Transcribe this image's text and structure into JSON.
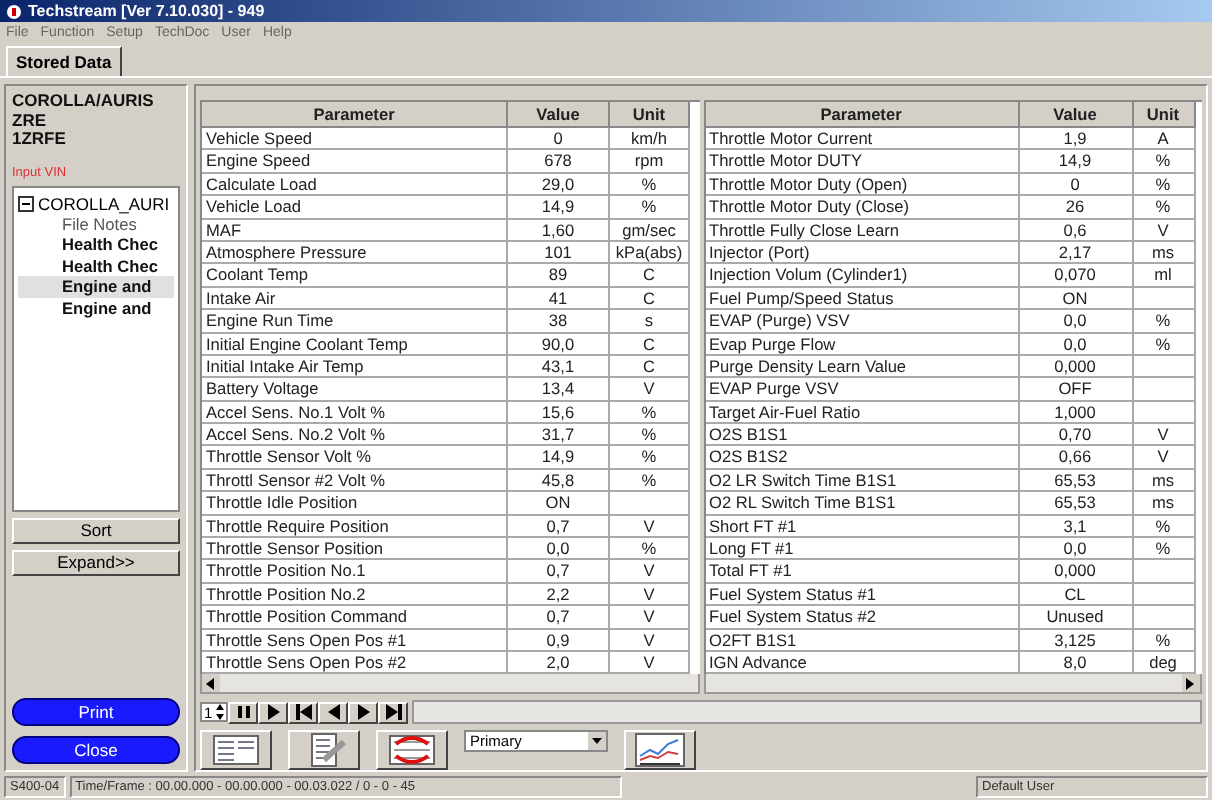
{
  "window": {
    "title": "Techstream [Ver 7.10.030] - 949"
  },
  "menu": [
    "File",
    "Function",
    "Setup",
    "TechDoc",
    "User",
    "Help"
  ],
  "tabs": [
    {
      "label": "Stored Data",
      "selected": true
    }
  ],
  "sidebar": {
    "vehicle": [
      "COROLLA/AURIS",
      "ZRE",
      "1ZRFE"
    ],
    "input_vin": "Input VIN",
    "tree": {
      "label": "COROLLA_AURI",
      "expanded": true,
      "children": [
        {
          "label": "File Notes",
          "bold": false,
          "selected": false
        },
        {
          "label": "Health Chec",
          "bold": true,
          "selected": false
        },
        {
          "label": "Health Chec",
          "bold": true,
          "selected": false
        },
        {
          "label": "Engine and",
          "bold": true,
          "selected": true
        },
        {
          "label": "Engine and",
          "bold": true,
          "selected": false
        }
      ]
    },
    "buttons": [
      "Sort",
      "Expand>>"
    ],
    "actions": [
      "Print",
      "Close"
    ]
  },
  "tables": [
    {
      "columns": [
        "Parameter",
        "Value",
        "Unit"
      ],
      "rows": [
        {
          "parameter": "Vehicle Speed",
          "value": "0",
          "unit": "km/h"
        },
        {
          "parameter": "Engine Speed",
          "value": "678",
          "unit": "rpm"
        },
        {
          "parameter": "Calculate Load",
          "value": "29,0",
          "unit": "%"
        },
        {
          "parameter": "Vehicle Load",
          "value": "14,9",
          "unit": "%"
        },
        {
          "parameter": "MAF",
          "value": "1,60",
          "unit": "gm/sec"
        },
        {
          "parameter": "Atmosphere Pressure",
          "value": "101",
          "unit": "kPa(abs)"
        },
        {
          "parameter": "Coolant Temp",
          "value": "89",
          "unit": "C"
        },
        {
          "parameter": "Intake Air",
          "value": "41",
          "unit": "C"
        },
        {
          "parameter": "Engine Run Time",
          "value": "38",
          "unit": "s"
        },
        {
          "parameter": "Initial Engine Coolant Temp",
          "value": "90,0",
          "unit": "C"
        },
        {
          "parameter": "Initial Intake Air Temp",
          "value": "43,1",
          "unit": "C"
        },
        {
          "parameter": "Battery Voltage",
          "value": "13,4",
          "unit": "V"
        },
        {
          "parameter": "Accel Sens. No.1 Volt %",
          "value": "15,6",
          "unit": "%"
        },
        {
          "parameter": "Accel Sens. No.2 Volt %",
          "value": "31,7",
          "unit": "%"
        },
        {
          "parameter": "Throttle Sensor Volt %",
          "value": "14,9",
          "unit": "%"
        },
        {
          "parameter": "Throttl Sensor #2 Volt %",
          "value": "45,8",
          "unit": "%"
        },
        {
          "parameter": "Throttle Idle Position",
          "value": "ON"
        },
        {
          "parameter": "Throttle Require Position",
          "value": "0,7",
          "unit": "V"
        },
        {
          "parameter": "Throttle Sensor Position",
          "value": "0,0",
          "unit": "%"
        },
        {
          "parameter": "Throttle Position No.1",
          "value": "0,7",
          "unit": "V"
        },
        {
          "parameter": "Throttle Position No.2",
          "value": "2,2",
          "unit": "V"
        },
        {
          "parameter": "Throttle Position Command",
          "value": "0,7",
          "unit": "V"
        },
        {
          "parameter": "Throttle Sens Open Pos #1",
          "value": "0,9",
          "unit": "V"
        },
        {
          "parameter": "Throttle Sens Open Pos #2",
          "value": "2,0",
          "unit": "V"
        }
      ]
    },
    {
      "columns": [
        "Parameter",
        "Value",
        "Unit"
      ],
      "rows": [
        {
          "parameter": "Throttle Motor Current",
          "value": "1,9",
          "unit": "A"
        },
        {
          "parameter": "Throttle Motor DUTY",
          "value": "14,9",
          "unit": "%"
        },
        {
          "parameter": "Throttle Motor Duty (Open)",
          "value": "0",
          "unit": "%"
        },
        {
          "parameter": "Throttle Motor Duty (Close)",
          "value": "26",
          "unit": "%"
        },
        {
          "parameter": "Throttle Fully Close Learn",
          "value": "0,6",
          "unit": "V"
        },
        {
          "parameter": "Injector (Port)",
          "value": "2,17",
          "unit": "ms"
        },
        {
          "parameter": "Injection Volum (Cylinder1)",
          "value": "0,070",
          "unit": "ml"
        },
        {
          "parameter": "Fuel Pump/Speed Status",
          "value": "ON"
        },
        {
          "parameter": "EVAP (Purge) VSV",
          "value": "0,0",
          "unit": "%"
        },
        {
          "parameter": "Evap Purge Flow",
          "value": "0,0",
          "unit": "%"
        },
        {
          "parameter": "Purge Density Learn Value",
          "value": "0,000"
        },
        {
          "parameter": "EVAP Purge VSV",
          "value": "OFF"
        },
        {
          "parameter": "Target Air-Fuel Ratio",
          "value": "1,000"
        },
        {
          "parameter": "O2S B1S1",
          "value": "0,70",
          "unit": "V"
        },
        {
          "parameter": "O2S B1S2",
          "value": "0,66",
          "unit": "V"
        },
        {
          "parameter": "O2 LR Switch Time B1S1",
          "value": "65,53",
          "unit": "ms"
        },
        {
          "parameter": "O2 RL Switch Time B1S1",
          "value": "65,53",
          "unit": "ms"
        },
        {
          "parameter": "Short FT #1",
          "value": "3,1",
          "unit": "%"
        },
        {
          "parameter": "Long FT #1",
          "value": "0,0",
          "unit": "%"
        },
        {
          "parameter": "Total FT #1",
          "value": "0,000"
        },
        {
          "parameter": "Fuel System Status #1",
          "value": "CL"
        },
        {
          "parameter": "Fuel System Status #2",
          "value": "Unused"
        },
        {
          "parameter": "O2FT B1S1",
          "value": "3,125",
          "unit": "%"
        },
        {
          "parameter": "IGN Advance",
          "value": "8,0",
          "unit": "deg"
        }
      ]
    }
  ],
  "playback": {
    "frame": "1"
  },
  "display_mode": "Primary",
  "status_bar": [
    "S400-04",
    "Time/Frame : 00.00.000 - 00.00.000 - 00.03.022 / 0 - 0 - 45",
    "Default User"
  ]
}
